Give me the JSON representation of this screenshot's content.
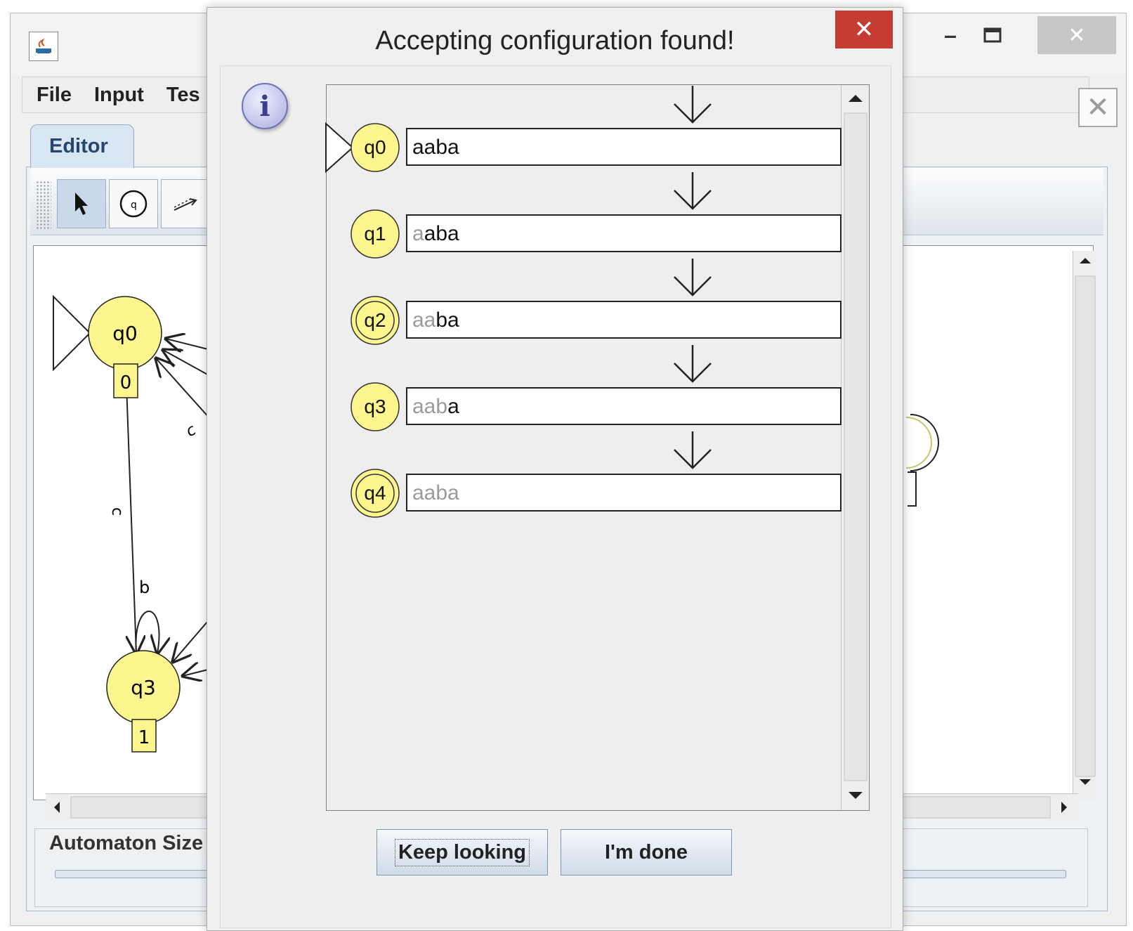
{
  "main_window": {
    "menu": [
      "File",
      "Input",
      "Tes"
    ],
    "editor_tab": "Editor",
    "canvas_states": [
      {
        "name": "q0",
        "label": "0",
        "initial": true,
        "final": false
      },
      {
        "name": "q3",
        "label": "1",
        "initial": false,
        "final": false
      }
    ],
    "canvas_edge_labels": [
      "c",
      "c",
      "b"
    ],
    "size_label": "Automaton Size"
  },
  "dialog": {
    "title": "Accepting configuration found!",
    "configurations": [
      {
        "state": "q0",
        "initial": true,
        "final": false,
        "tape": "aaba",
        "consumed": 0
      },
      {
        "state": "q1",
        "initial": false,
        "final": false,
        "tape": "aaba",
        "consumed": 1
      },
      {
        "state": "q2",
        "initial": false,
        "final": true,
        "tape": "aaba",
        "consumed": 2
      },
      {
        "state": "q3",
        "initial": false,
        "final": false,
        "tape": "aaba",
        "consumed": 3
      },
      {
        "state": "q4",
        "initial": false,
        "final": true,
        "tape": "aaba",
        "consumed": 4
      }
    ],
    "buttons": {
      "keep_looking": "Keep looking",
      "done": "I'm done"
    }
  },
  "colors": {
    "state_fill": "#fdf58d",
    "dialog_close": "#c43c33",
    "tab_bg": "#d9e6f4"
  }
}
